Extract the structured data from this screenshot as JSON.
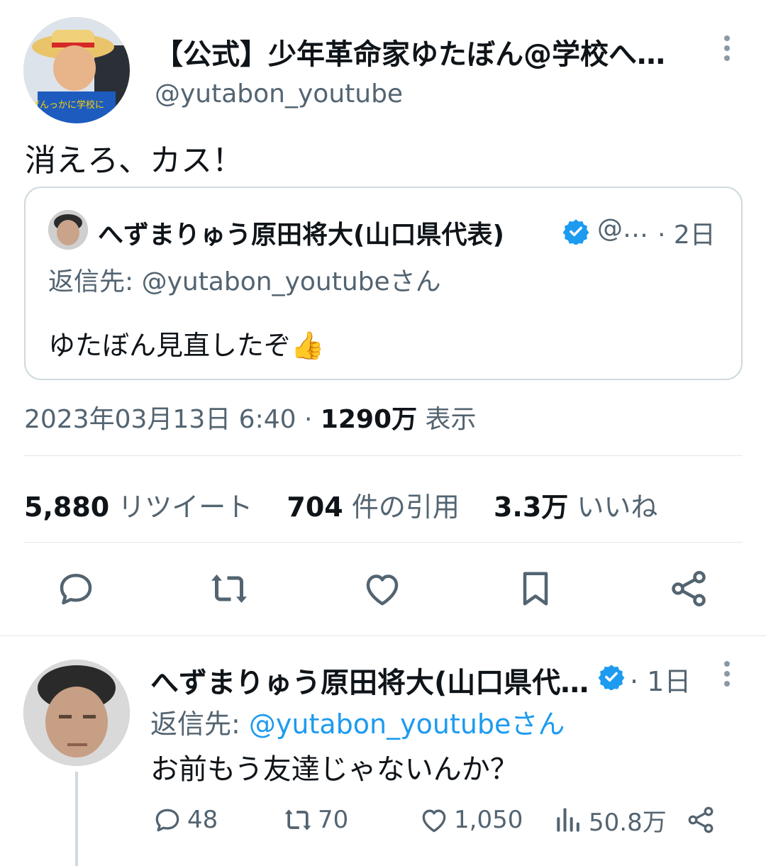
{
  "main_tweet": {
    "author_name": "【公式】少年革命家ゆたぼん@学校へ…",
    "author_handle": "@yutabon_youtube",
    "avatar_caption": "ぜんっかに学校に",
    "text": "消えろ、カス！",
    "timestamp": "2023年03月13日 6:40 ·",
    "views_count": "1290万",
    "views_label": "表示"
  },
  "quote": {
    "author_name": "へずまりゅう原田将大(山口県代表)",
    "handle": "@…",
    "time": "· 2日",
    "reply_to": "返信先: @yutabon_youtubeさん",
    "text": "ゆたぼん見直したぞ👍"
  },
  "stats": {
    "retweets_count": "5,880",
    "retweets_label": "リツイート",
    "quotes_count": "704",
    "quotes_label": "件の引用",
    "likes_count": "3.3万",
    "likes_label": "いいね"
  },
  "actions": {
    "icons": [
      "reply-icon",
      "retweet-icon",
      "like-icon",
      "bookmark-icon",
      "share-icon"
    ]
  },
  "reply_tweet": {
    "author_name": "へずまりゅう原田将大(山口県代…",
    "time": "· 1日",
    "reply_prefix": "返信先:",
    "reply_mention": "@yutabon_youtubeさん",
    "text": "お前もう友達じゃないんか？",
    "reply_count": "48",
    "retweet_count": "70",
    "like_count": "1,050",
    "view_count": "50.8万"
  },
  "colors": {
    "accent": "#1d9bf0",
    "secondary_text": "#536471",
    "divider": "#e1e8ed"
  }
}
